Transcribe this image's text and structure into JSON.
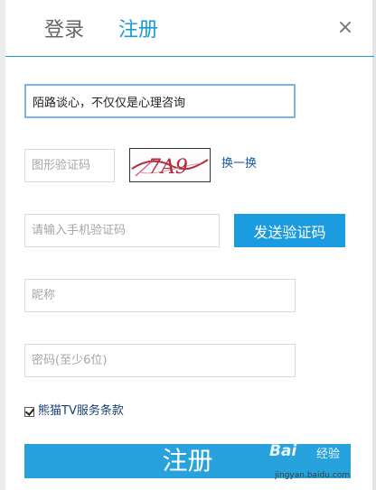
{
  "tabs": {
    "login": "登录",
    "register": "注册"
  },
  "close_symbol": "×",
  "form": {
    "intro_value": "陌路谈心，不仅仅是心理咨询",
    "captcha_placeholder": "图形验证码",
    "captcha_image_text": "7A9",
    "refresh_label": "换一换",
    "sms_placeholder": "请输入手机验证码",
    "sms_button": "发送验证码",
    "nickname_placeholder": "昵称",
    "password_placeholder": "密码(至少6位)",
    "terms_label": "熊猫TV服务条款",
    "terms_checked": true,
    "submit_label": "注册"
  },
  "watermark": {
    "logo": "Bai",
    "text": "经验",
    "url": "jingyan.baidu.com"
  },
  "colors": {
    "accent": "#1a9ad6",
    "button": "#1b9be0",
    "submit": "#28a2dd",
    "link": "#1a56a6"
  }
}
